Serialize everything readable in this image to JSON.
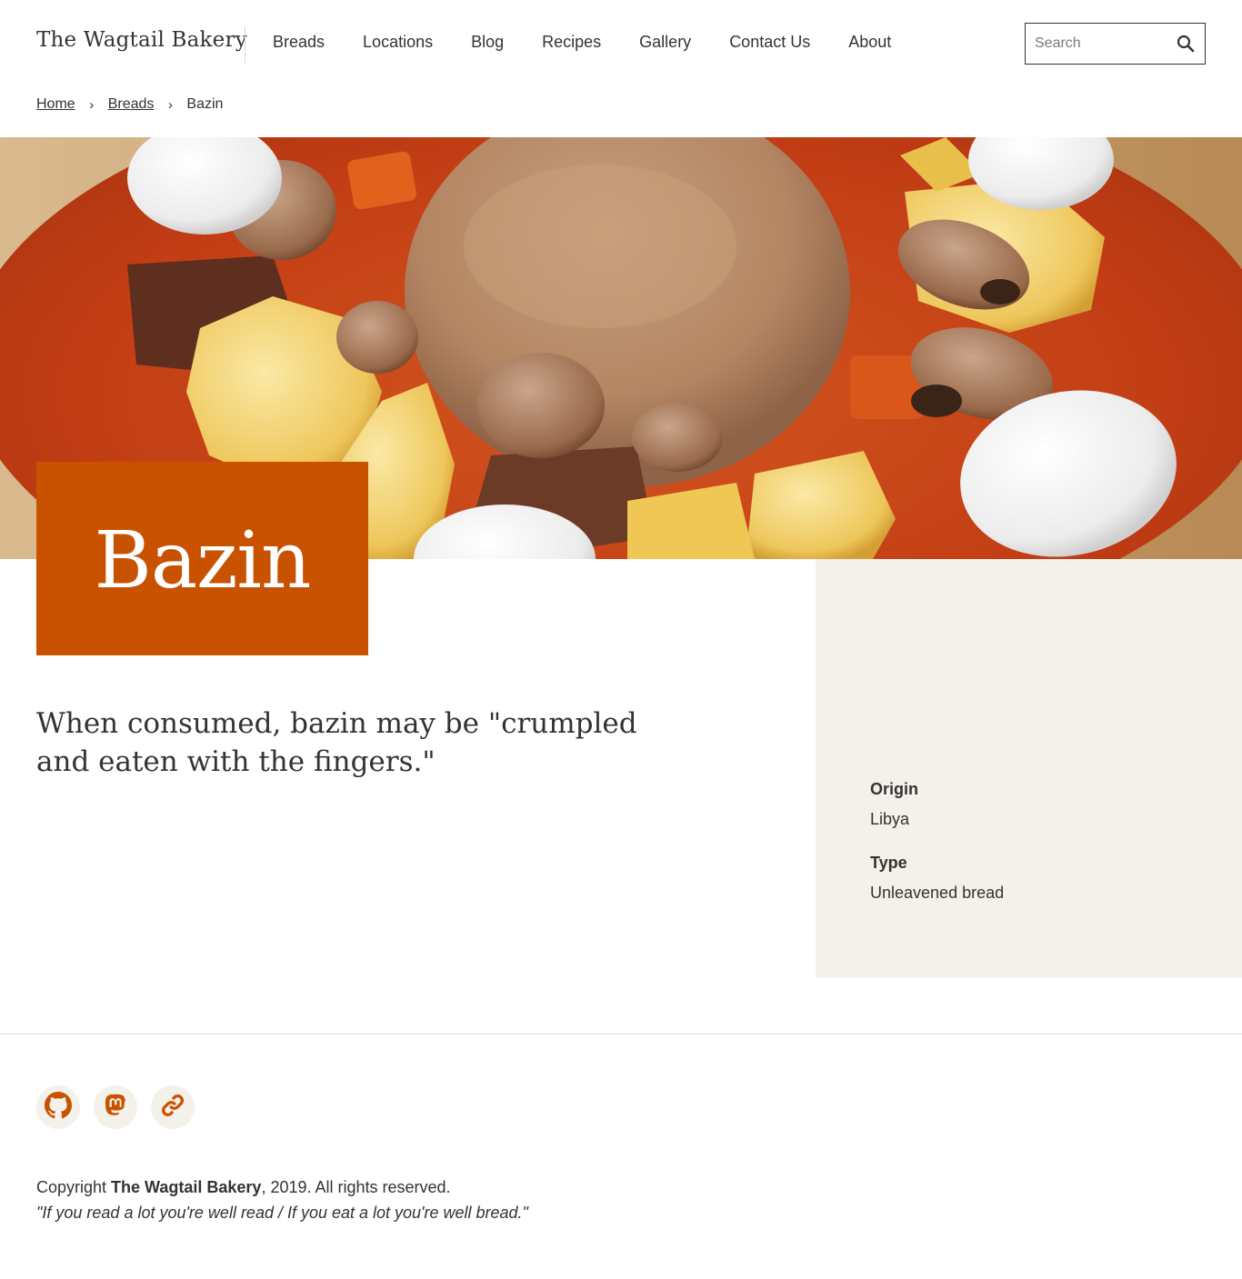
{
  "site": {
    "title": "The Wagtail Bakery"
  },
  "nav": {
    "items": [
      {
        "label": "Breads"
      },
      {
        "label": "Locations"
      },
      {
        "label": "Blog"
      },
      {
        "label": "Recipes"
      },
      {
        "label": "Gallery"
      },
      {
        "label": "Contact Us"
      },
      {
        "label": "About"
      }
    ]
  },
  "search": {
    "placeholder": "Search",
    "icon": "search-icon"
  },
  "breadcrumb": {
    "home": "Home",
    "breads": "Breads",
    "current": "Bazin",
    "separator": "›"
  },
  "page": {
    "title": "Bazin",
    "intro": "When consumed, bazin may be \"crumpled and eaten with the fingers.\"",
    "accent_color": "#c95200"
  },
  "details": {
    "origin_label": "Origin",
    "origin_value": "Libya",
    "type_label": "Type",
    "type_value": "Unleavened bread"
  },
  "footer": {
    "socials": [
      {
        "icon": "github-icon"
      },
      {
        "icon": "mastodon-icon"
      },
      {
        "icon": "link-icon"
      }
    ],
    "copyright_prefix": "Copyright ",
    "copyright_name": "The Wagtail Bakery",
    "copyright_suffix": ", 2019. All rights reserved.",
    "motto": "\"If you read a lot you're well read / If you eat a lot you're well bread.\""
  }
}
